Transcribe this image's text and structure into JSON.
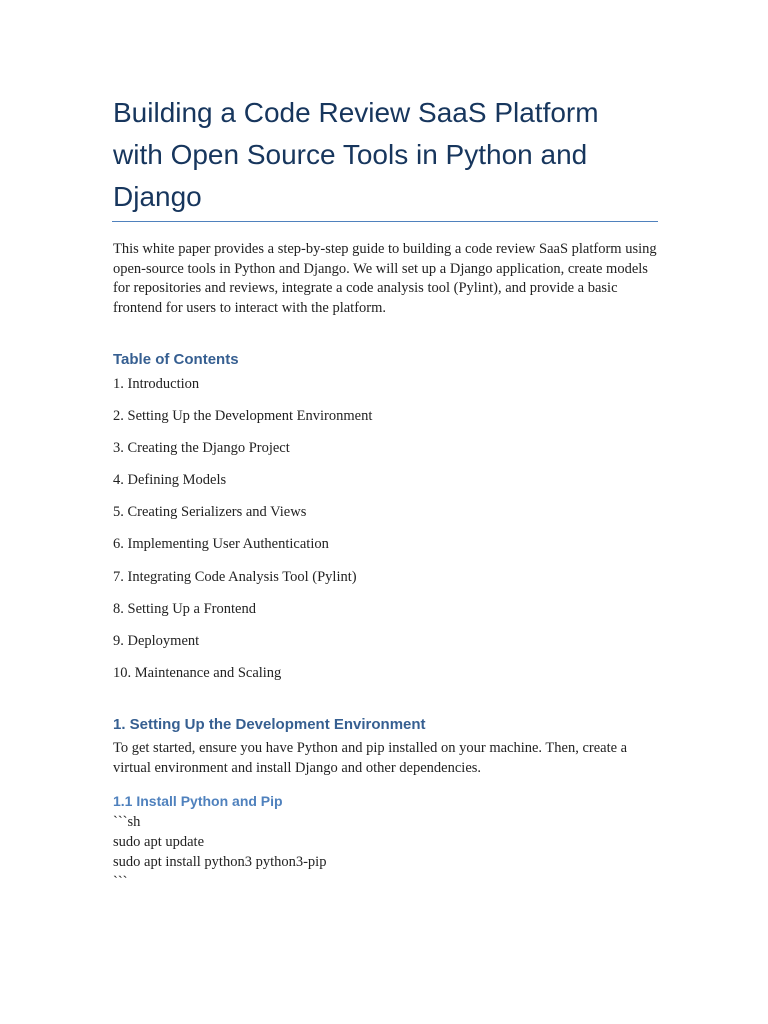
{
  "title": "Building a Code Review SaaS Platform with Open Source Tools in Python and Django",
  "intro": "This white paper provides a step-by-step guide to building a code review SaaS platform using open-source tools in Python and Django. We will set up a Django application, create models for repositories and reviews, integrate a code analysis tool (Pylint), and provide a basic frontend for users to interact with the platform.",
  "toc": {
    "heading": "Table of Contents",
    "items": [
      "1. Introduction",
      "2. Setting Up the Development Environment",
      "3. Creating the Django Project",
      "4. Defining Models",
      "5. Creating Serializers and Views",
      "6. Implementing User Authentication",
      "7. Integrating Code Analysis Tool (Pylint)",
      "8. Setting Up a Frontend",
      "9. Deployment",
      "10. Maintenance and Scaling"
    ]
  },
  "section1": {
    "heading": "1. Setting Up the Development Environment",
    "text": "To get started, ensure you have Python and pip installed on your machine. Then, create a virtual environment and install Django and other dependencies.",
    "sub": {
      "heading": "1.1 Install Python and Pip",
      "code": [
        "```sh",
        "sudo apt update",
        "sudo apt install python3 python3-pip",
        "```"
      ]
    }
  },
  "colors": {
    "title": "#17365D",
    "heading": "#365F91",
    "subheading": "#4F81BD"
  }
}
